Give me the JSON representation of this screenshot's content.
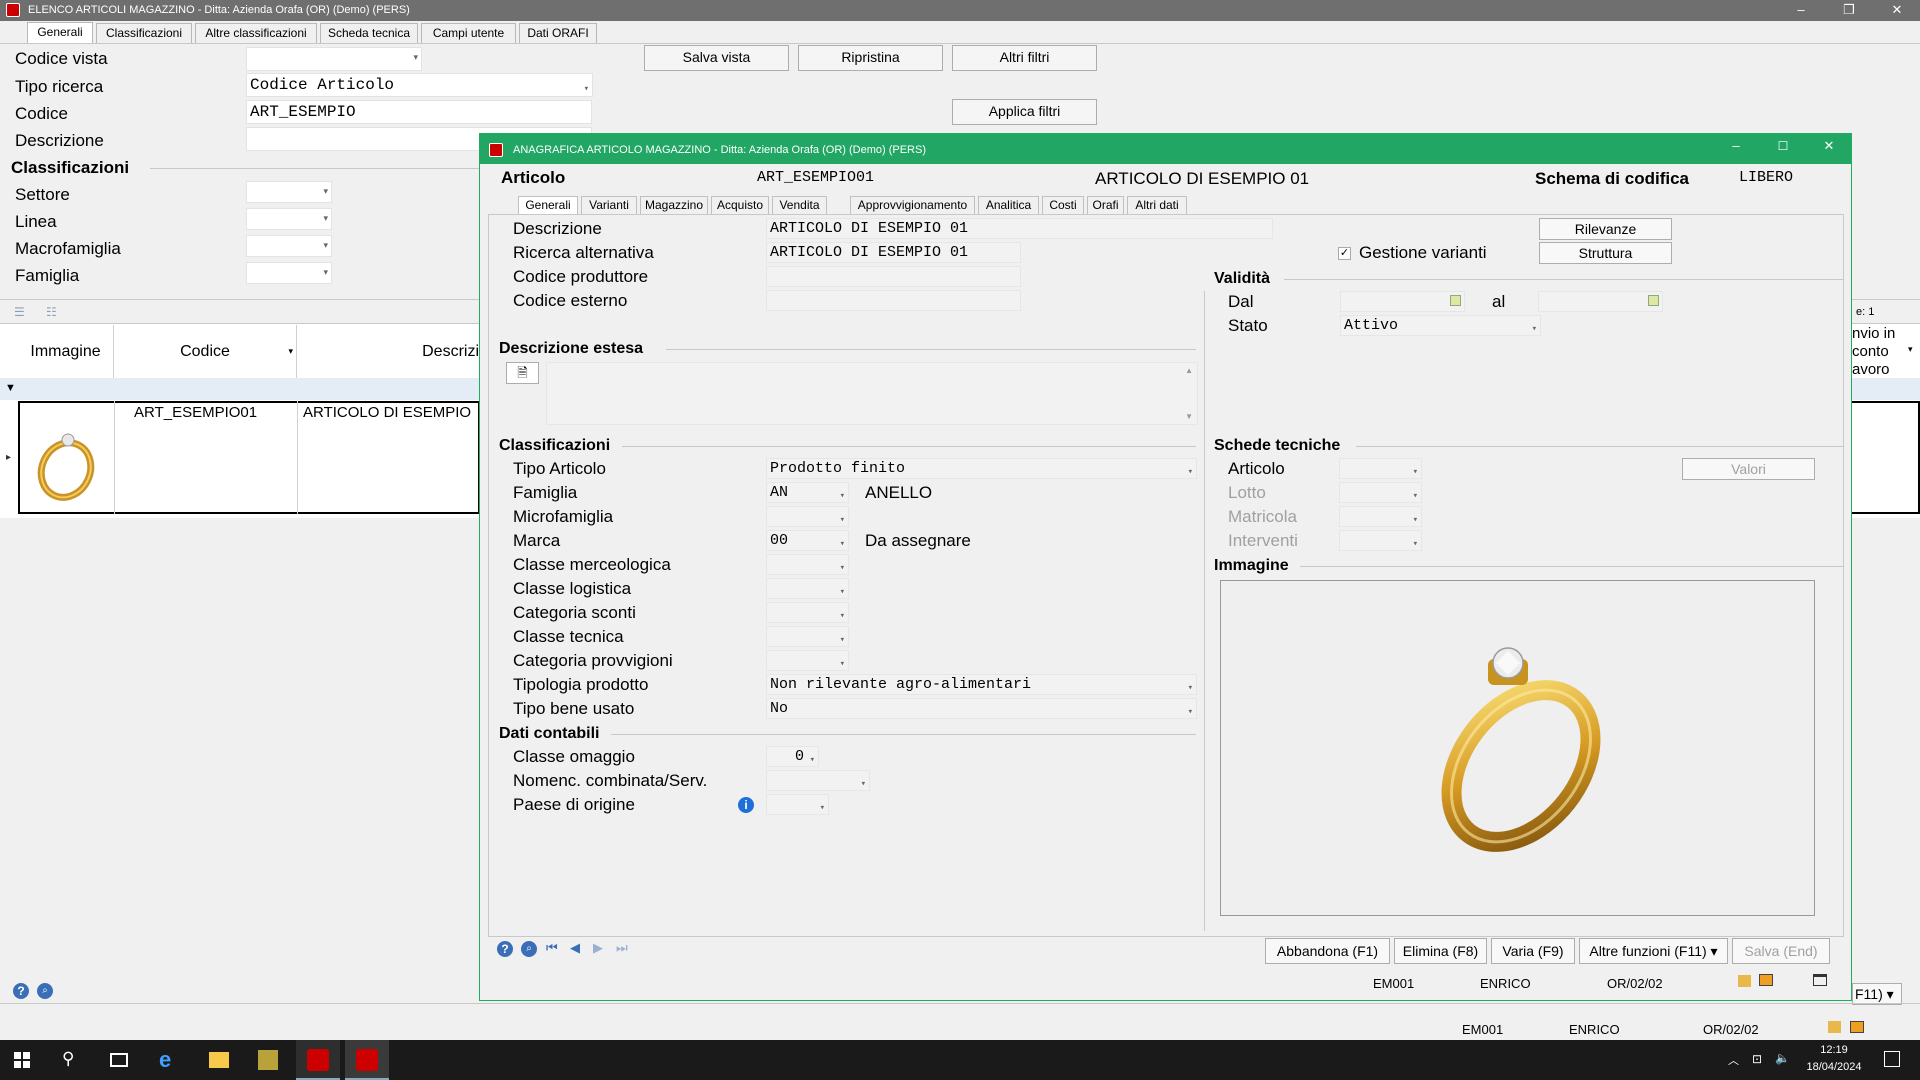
{
  "main_window": {
    "title": "ELENCO ARTICOLI MAGAZZINO - Ditta: Azienda Orafa (OR)  (Demo) (PERS)",
    "controls": {
      "minimize": "–",
      "restore": "❐",
      "close": "✕"
    }
  },
  "main_tabs": [
    "Generali",
    "Classificazioni",
    "Altre classificazioni",
    "Scheda tecnica",
    "Campi utente",
    "Dati ORAFI"
  ],
  "filters": {
    "codice_vista_label": "Codice vista",
    "codice_vista_value": "",
    "tipo_ricerca_label": "Tipo ricerca",
    "tipo_ricerca_value": "Codice Articolo",
    "codice_label": "Codice",
    "codice_value": "ART_ESEMPIO",
    "descrizione_label": "Descrizione",
    "descrizione_value": ""
  },
  "filter_buttons": {
    "salva_vista": "Salva vista",
    "ripristina": "Ripristina",
    "altri_filtri": "Altri filtri",
    "applica_filtri": "Applica filtri"
  },
  "classificazioni": {
    "title": "Classificazioni",
    "settore": "Settore",
    "linea": "Linea",
    "macrofamiglia": "Macrofamiglia",
    "famiglia": "Famiglia"
  },
  "grid": {
    "col_immagine": "Immagine",
    "col_codice": "Codice",
    "col_descrizione": "Descrizi",
    "col_right_line1": "nvio in",
    "col_right_line2": "conto",
    "col_right_line3": "avoro",
    "right_header_fragment": "e: 1",
    "row_codice": "ART_ESEMPIO01",
    "row_descrizione": "ARTICOLO DI ESEMPIO"
  },
  "main_status": {
    "azienda": "EM001",
    "utente": "ENRICO",
    "data": "OR/02/02",
    "altre_fragment": "F11)"
  },
  "dialog": {
    "title": "ANAGRAFICA ARTICOLO MAGAZZINO - Ditta: Azienda Orafa (OR)  (Demo) (PERS)",
    "articolo_label": "Articolo",
    "articolo_code": "ART_ESEMPIO01",
    "articolo_desc": "ARTICOLO DI ESEMPIO 01",
    "schema_label": "Schema di codifica",
    "schema_value": "LIBERO",
    "tabs": [
      "Generali",
      "Varianti",
      "Magazzino",
      "Acquisto",
      "Vendita",
      "Approvvigionamento",
      "Analitica",
      "Costi",
      "Orafi",
      "Altri dati"
    ],
    "descrizione_label": "Descrizione",
    "descrizione_value": "ARTICOLO DI ESEMPIO 01",
    "ricerca_label": "Ricerca alternativa",
    "ricerca_value": "ARTICOLO DI ESEMPIO 01",
    "produttore_label": "Codice produttore",
    "esterno_label": "Codice esterno",
    "rilevanze": "Rilevanze",
    "struttura": "Struttura",
    "gestione_varianti": "Gestione varianti",
    "check": "✓",
    "validita": "Validità",
    "dal": "Dal",
    "al": "al",
    "stato_label": "Stato",
    "stato_value": "Attivo",
    "desc_estesa": "Descrizione estesa",
    "classificazioni": "Classificazioni",
    "tipo_articolo_label": "Tipo Articolo",
    "tipo_articolo_value": "Prodotto finito",
    "famiglia_label": "Famiglia",
    "famiglia_value": "AN",
    "famiglia_desc": "ANELLO",
    "microfamiglia_label": "Microfamiglia",
    "marca_label": "Marca",
    "marca_value": "00",
    "marca_desc": "Da assegnare",
    "classe_merc_label": "Classe merceologica",
    "classe_log_label": "Classe logistica",
    "cat_sconti_label": "Categoria sconti",
    "classe_tec_label": "Classe tecnica",
    "cat_provv_label": "Categoria provvigioni",
    "tipologia_label": "Tipologia prodotto",
    "tipologia_value": "Non rilevante agro-alimentari",
    "bene_usato_label": "Tipo bene usato",
    "bene_usato_value": "No",
    "dati_contabili": "Dati contabili",
    "omaggio_label": "Classe omaggio",
    "omaggio_value": "0",
    "nomenc_label": "Nomenc. combinata/Serv.",
    "paese_label": "Paese di origine",
    "schede_tecniche": "Schede tecniche",
    "st_articolo": "Articolo",
    "st_lotto": "Lotto",
    "st_matricola": "Matricola",
    "st_interventi": "Interventi",
    "valori": "Valori",
    "immagine": "Immagine",
    "btn_abbandona": "Abbandona (F1)",
    "btn_elimina": "Elimina (F8)",
    "btn_varia": "Varia (F9)",
    "btn_altre": "Altre funzioni (F11)",
    "btn_salva": "Salva (End)",
    "status_azienda": "EM001",
    "status_utente": "ENRICO",
    "status_data": "OR/02/02"
  },
  "taskbar": {
    "time": "12:19",
    "date": "18/04/2024"
  },
  "colors": {
    "dialog_accent": "#21a763",
    "main_title": "#6f6f6f",
    "info_blue": "#1e6fd9"
  }
}
